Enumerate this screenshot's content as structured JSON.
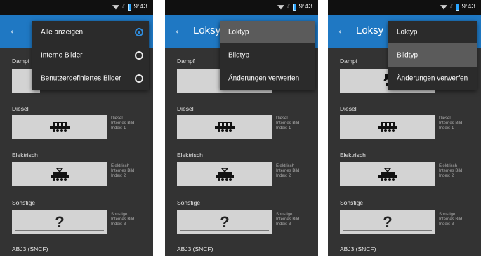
{
  "status": {
    "time": "9:43",
    "signal_glyph": "⫽"
  },
  "screen1": {
    "menu": [
      {
        "label": "Alle anzeigen",
        "radio_selected": true
      },
      {
        "label": "Interne Bilder",
        "radio_selected": false
      },
      {
        "label": "Benutzerdefiniertes Bilder",
        "radio_selected": false
      }
    ],
    "sections": {
      "dampf": "Dampf"
    }
  },
  "screen2": {
    "title": "Loksy",
    "menu": [
      {
        "label": "Loktyp",
        "highlighted": true
      },
      {
        "label": "Bildtyp",
        "highlighted": false
      },
      {
        "label": "Änderungen verwerfen",
        "highlighted": false
      }
    ]
  },
  "screen3": {
    "title": "Loksy",
    "menu": [
      {
        "label": "Loktyp",
        "highlighted": false
      },
      {
        "label": "Bildtyp",
        "highlighted": true
      },
      {
        "label": "Änderungen verwerfen",
        "highlighted": false
      }
    ]
  },
  "sections": {
    "dampf": "Dampf",
    "diesel": "Diesel",
    "elektrisch": "Elektrisch",
    "sonstige": "Sonstige",
    "next_item": "ABJ3 (SNCF)"
  },
  "cards": {
    "diesel": {
      "name": "Diesel",
      "type": "Internes Bild",
      "index": "Index: 1",
      "icon": "diesel-loco-icon"
    },
    "elektrisch": {
      "name": "Elektrisch",
      "type": "Internes Bild",
      "index": "Index: 2",
      "icon": "electric-loco-icon"
    },
    "sonstige": {
      "name": "Sonstige",
      "type": "Internes Bild",
      "index": "Index: 3",
      "icon": "question-mark-icon",
      "glyph": "?"
    }
  },
  "colors": {
    "appbar": "#1f78c3",
    "background": "#333333",
    "accent": "#2f8ee0"
  }
}
